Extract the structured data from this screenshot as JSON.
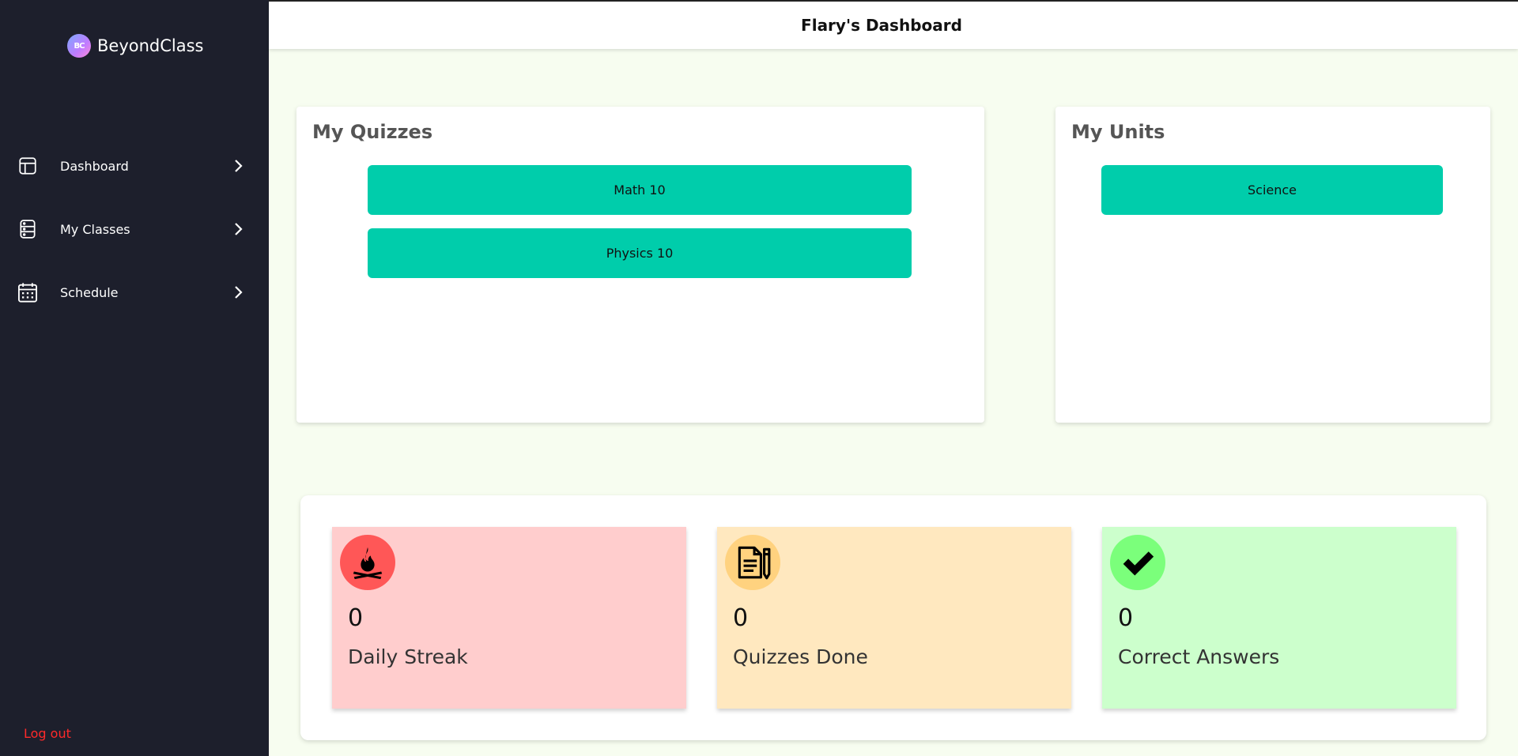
{
  "brand": {
    "name": "BeyondClass",
    "logo_text": "BC"
  },
  "sidebar": {
    "items": [
      {
        "label": "Dashboard",
        "icon": "layout-icon"
      },
      {
        "label": "My Classes",
        "icon": "server-icon"
      },
      {
        "label": "Schedule",
        "icon": "calendar-icon"
      }
    ],
    "logout_label": "Log out"
  },
  "header": {
    "title": "Flary's Dashboard"
  },
  "quizzes": {
    "title": "My Quizzes",
    "items": [
      "Math 10",
      "Physics 10"
    ]
  },
  "units": {
    "title": "My Units",
    "items": [
      "Science"
    ]
  },
  "stats": [
    {
      "value": "0",
      "label": "Daily Streak",
      "icon": "campfire-icon",
      "bg": "#ffcdcd",
      "icon_bg": "#ff5757"
    },
    {
      "value": "0",
      "label": "Quizzes Done",
      "icon": "document-pencil-icon",
      "bg": "#ffe8bf",
      "icon_bg": "#ffd27f"
    },
    {
      "value": "0",
      "label": "Correct Answers",
      "icon": "checkmark-icon",
      "bg": "#ccffcc",
      "icon_bg": "#7bff7b"
    }
  ],
  "colors": {
    "accent": "#00cdab",
    "sidebar_bg": "#1d1f2c",
    "logout": "#ff2a2a"
  }
}
